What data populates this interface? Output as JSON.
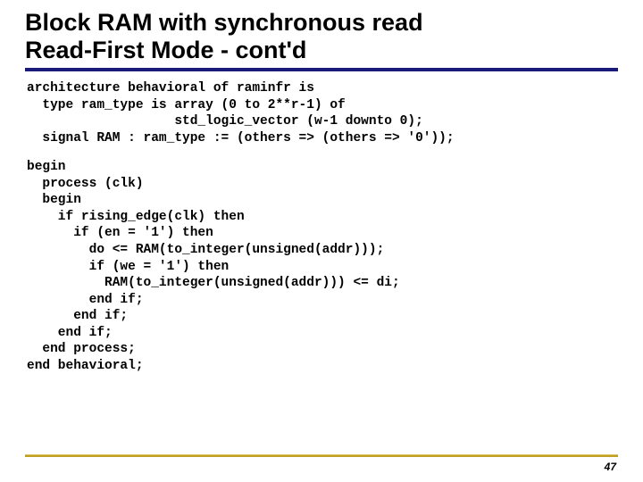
{
  "title": {
    "line1": "Block RAM with synchronous read",
    "line2": "Read-First Mode - cont'd"
  },
  "code": {
    "block1": "architecture behavioral of raminfr is\n  type ram_type is array (0 to 2**r-1) of\n                   std_logic_vector (w-1 downto 0);\n  signal RAM : ram_type := (others => (others => '0'));",
    "block2": "begin\n  process (clk)\n  begin\n    if rising_edge(clk) then\n      if (en = '1') then\n        do <= RAM(to_integer(unsigned(addr)));\n        if (we = '1') then\n          RAM(to_integer(unsigned(addr))) <= di;\n        end if;\n      end if;\n    end if;\n  end process;\nend behavioral;"
  },
  "page": "47"
}
